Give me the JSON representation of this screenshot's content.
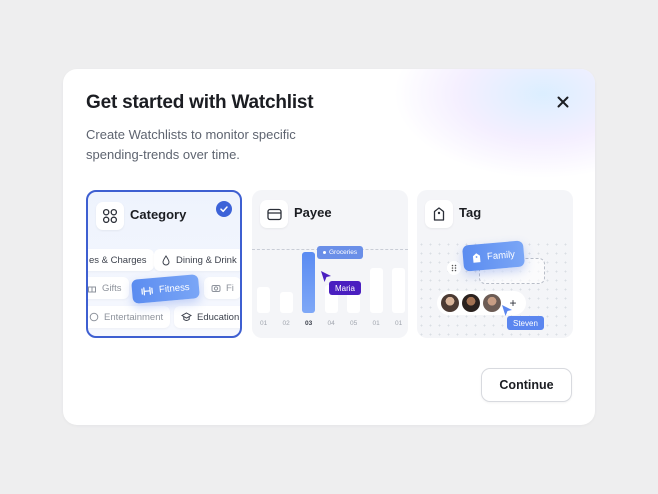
{
  "dialog": {
    "title": "Get started with Watchlist",
    "description": "Create Watchlists to monitor specific spending-trends over time.",
    "close_icon": "close-icon",
    "continue_label": "Continue"
  },
  "options": [
    {
      "label": "Category",
      "icon": "grid-icon",
      "selected": true
    },
    {
      "label": "Payee",
      "icon": "card-icon",
      "selected": false
    },
    {
      "label": "Tag",
      "icon": "tag-icon",
      "selected": false
    }
  ],
  "category_preview": {
    "chips": [
      "es & Charges",
      "Dining & Drink",
      "Gifts",
      "Fi",
      "Entertainment",
      "Education"
    ],
    "floating_tag": "Fitness"
  },
  "payee_preview": {
    "bar_labels": [
      "01",
      "02",
      "03",
      "04",
      "05",
      "01",
      "01"
    ],
    "highlighted_index": 2,
    "bar_levels": [
      0.4,
      0.32,
      0.92,
      0.42,
      0.44,
      0.68,
      0.68
    ],
    "groceries_label": "Groceries",
    "cursor_user": "Maria"
  },
  "tag_preview": {
    "floating_tag": "Family",
    "add_symbol": "+",
    "cursor_user": "Steven"
  },
  "colors": {
    "accent": "#3d63d8",
    "selected_border": "#3e5fd1",
    "tag_gradient_start": "#5b8cf0",
    "maria_label": "#4a1fc0"
  }
}
